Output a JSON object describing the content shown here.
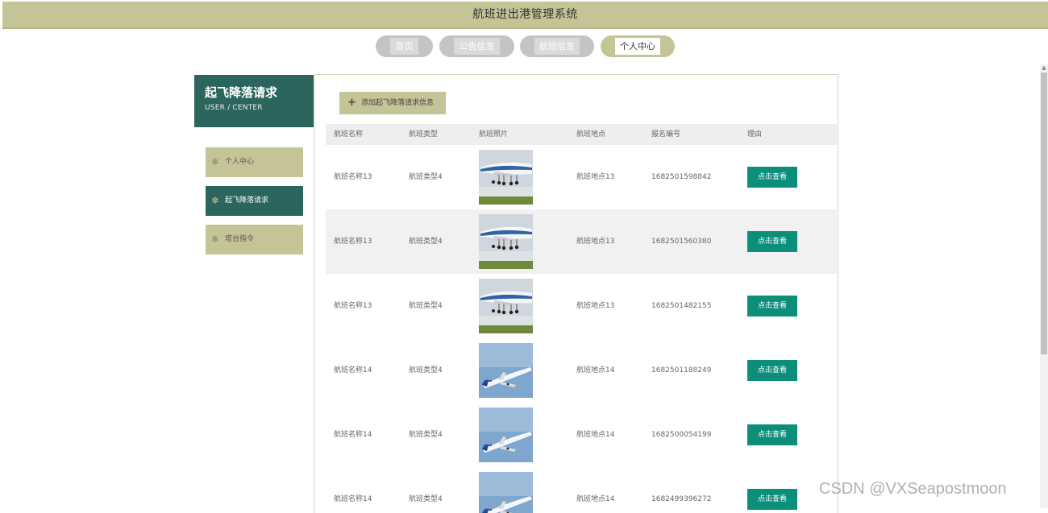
{
  "app": {
    "title": "航班进出港管理系统"
  },
  "nav": [
    {
      "label": "首页"
    },
    {
      "label": "公告信息"
    },
    {
      "label": "航班信息"
    },
    {
      "label": "个人中心",
      "active": true
    }
  ],
  "sidebar": {
    "title": "起飞降落请求",
    "subtitle": "USER / CENTER",
    "items": [
      {
        "label": "个人中心",
        "icon": "snowflake-icon"
      },
      {
        "label": "起飞降落请求",
        "icon": "snowflake-icon",
        "active": true
      },
      {
        "label": "塔台指令",
        "icon": "snowflake-icon"
      }
    ]
  },
  "toolbar": {
    "add_label": "添加起飞降落请求信息"
  },
  "table": {
    "columns": [
      "航班名称",
      "航班类型",
      "航班照片",
      "航班地点",
      "报名编号",
      "理由"
    ],
    "rows": [
      {
        "name": "航班名称13",
        "type": "航班类型4",
        "photo": "plane-landing",
        "place": "航班地点13",
        "code": "1682501598842",
        "action": "点击查看"
      },
      {
        "name": "航班名称13",
        "type": "航班类型4",
        "photo": "plane-landing",
        "place": "航班地点13",
        "code": "1682501560380",
        "action": "点击查看"
      },
      {
        "name": "航班名称13",
        "type": "航班类型4",
        "photo": "plane-landing",
        "place": "航班地点13",
        "code": "1682501482155",
        "action": "点击查看"
      },
      {
        "name": "航班名称14",
        "type": "航班类型4",
        "photo": "plane-takeoff",
        "place": "航班地点14",
        "code": "1682501188249",
        "action": "点击查看"
      },
      {
        "name": "航班名称14",
        "type": "航班类型4",
        "photo": "plane-takeoff",
        "place": "航班地点14",
        "code": "1682500054199",
        "action": "点击查看"
      },
      {
        "name": "航班名称14",
        "type": "航班类型4",
        "photo": "plane-takeoff",
        "place": "航班地点14",
        "code": "1682499396272",
        "action": "点击查看"
      }
    ]
  },
  "watermark": "CSDN @VXSeapostmoon",
  "colors": {
    "accent": "#c4c496",
    "primary": "#2b655d",
    "button": "#0c8f7a"
  }
}
